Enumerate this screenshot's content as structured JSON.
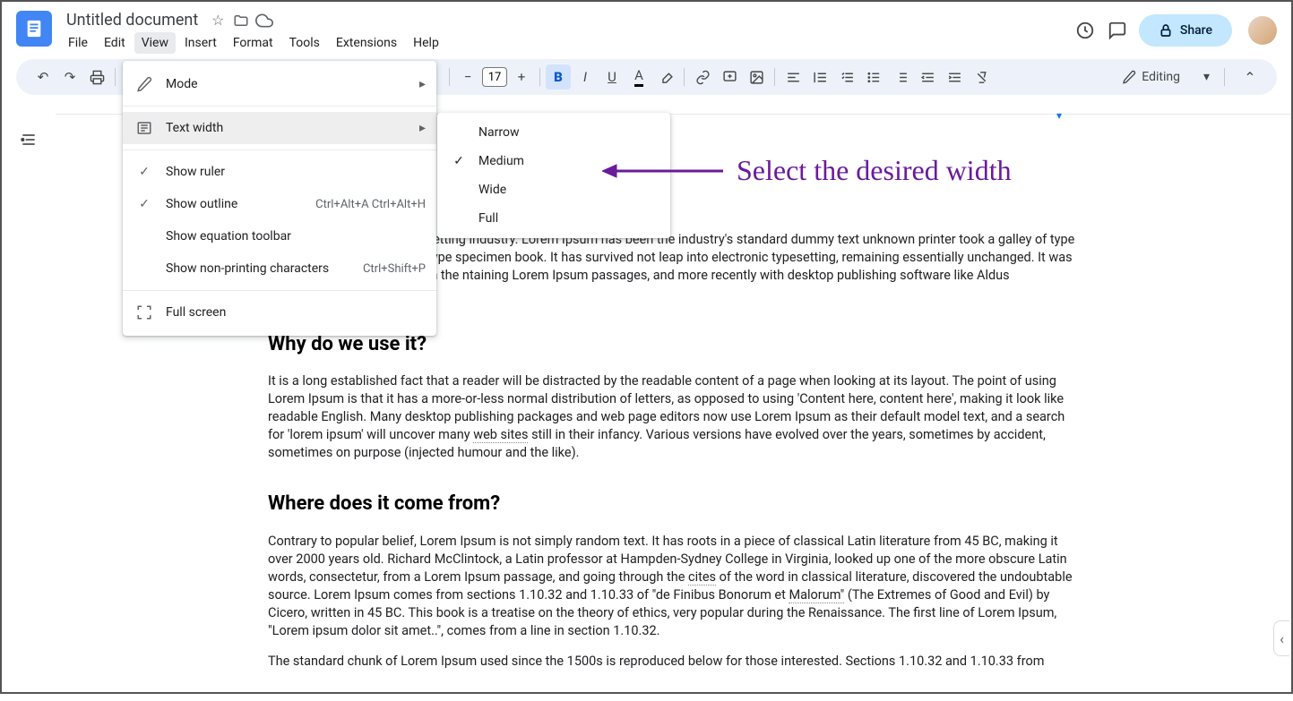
{
  "header": {
    "title": "Untitled document",
    "share_label": "Share"
  },
  "menubar": [
    "File",
    "Edit",
    "View",
    "Insert",
    "Format",
    "Tools",
    "Extensions",
    "Help"
  ],
  "menubar_active": "View",
  "toolbar": {
    "font_size": "17",
    "editing_label": "Editing"
  },
  "view_menu": {
    "items": [
      {
        "icon": "pencil",
        "label": "Mode",
        "arrow": true
      },
      {
        "divider": true
      },
      {
        "icon": "text-width",
        "label": "Text width",
        "arrow": true,
        "highlighted": true
      },
      {
        "divider": true
      },
      {
        "icon": "check",
        "label": "Show ruler"
      },
      {
        "icon": "check",
        "label": "Show outline",
        "shortcut": "Ctrl+Alt+A Ctrl+Alt+H"
      },
      {
        "icon": "",
        "label": "Show equation toolbar"
      },
      {
        "icon": "",
        "label": "Show non-printing characters",
        "shortcut": "Ctrl+Shift+P"
      },
      {
        "divider": true
      },
      {
        "icon": "fullscreen",
        "label": "Full screen"
      }
    ]
  },
  "text_width_submenu": {
    "items": [
      {
        "label": "Narrow",
        "checked": false
      },
      {
        "label": "Medium",
        "checked": true
      },
      {
        "label": "Wide",
        "checked": false
      },
      {
        "label": "Full",
        "checked": false
      }
    ]
  },
  "annotation": "Select the desired width",
  "document": {
    "para1": " text of the printing and typesetting industry. Lorem Ipsum has been the industry's standard dummy text unknown printer took a galley of type and scrambled it to make a type specimen book. It has survived not leap into electronic typesetting, remaining essentially unchanged. It was popularised in the 1960s with the ntaining Lorem Ipsum passages, and more recently with desktop publishing software like Aldus PageMaker psum.",
    "h1": "Why do we use it?",
    "para2_a": "It is a long established fact that a reader will be distracted by the readable content of a page when looking at its layout. The point of using Lorem Ipsum is that it has a more-or-less normal distribution of letters, as opposed to using 'Content here, content here', making it look like readable English. Many desktop publishing packages and web page editors now use Lorem Ipsum as their default model text, and a search for 'lorem ipsum' will uncover many ",
    "para2_link": "web sites",
    "para2_b": " still in their infancy. Various versions have evolved over the years, sometimes by accident, sometimes on purpose (injected humour and the like).",
    "h2": "Where does it come from?",
    "para3_a": "Contrary to popular belief, Lorem Ipsum is not simply random text. It has roots in a piece of classical Latin literature from 45 BC, making it over 2000 years old. Richard McClintock, a Latin professor at Hampden-Sydney College in Virginia, looked up one of the more obscure Latin words, consectetur, from a Lorem Ipsum passage, and going through the ",
    "para3_link1": "cites",
    "para3_b": " of the word in classical literature, discovered the undoubtable source. Lorem Ipsum comes from sections 1.10.32 and 1.10.33 of \"de Finibus Bonorum et ",
    "para3_link2": "Malorum\"",
    "para3_c": " (The Extremes of Good and Evil) by Cicero, written in 45 BC. This book is a treatise on the theory of ethics, very popular during the Renaissance. The first line of Lorem Ipsum, \"Lorem ipsum dolor sit amet..\", comes from a line in section 1.10.32.",
    "para4": "The standard chunk of Lorem Ipsum used since the 1500s is reproduced below for those interested. Sections 1.10.32 and 1.10.33 from"
  }
}
